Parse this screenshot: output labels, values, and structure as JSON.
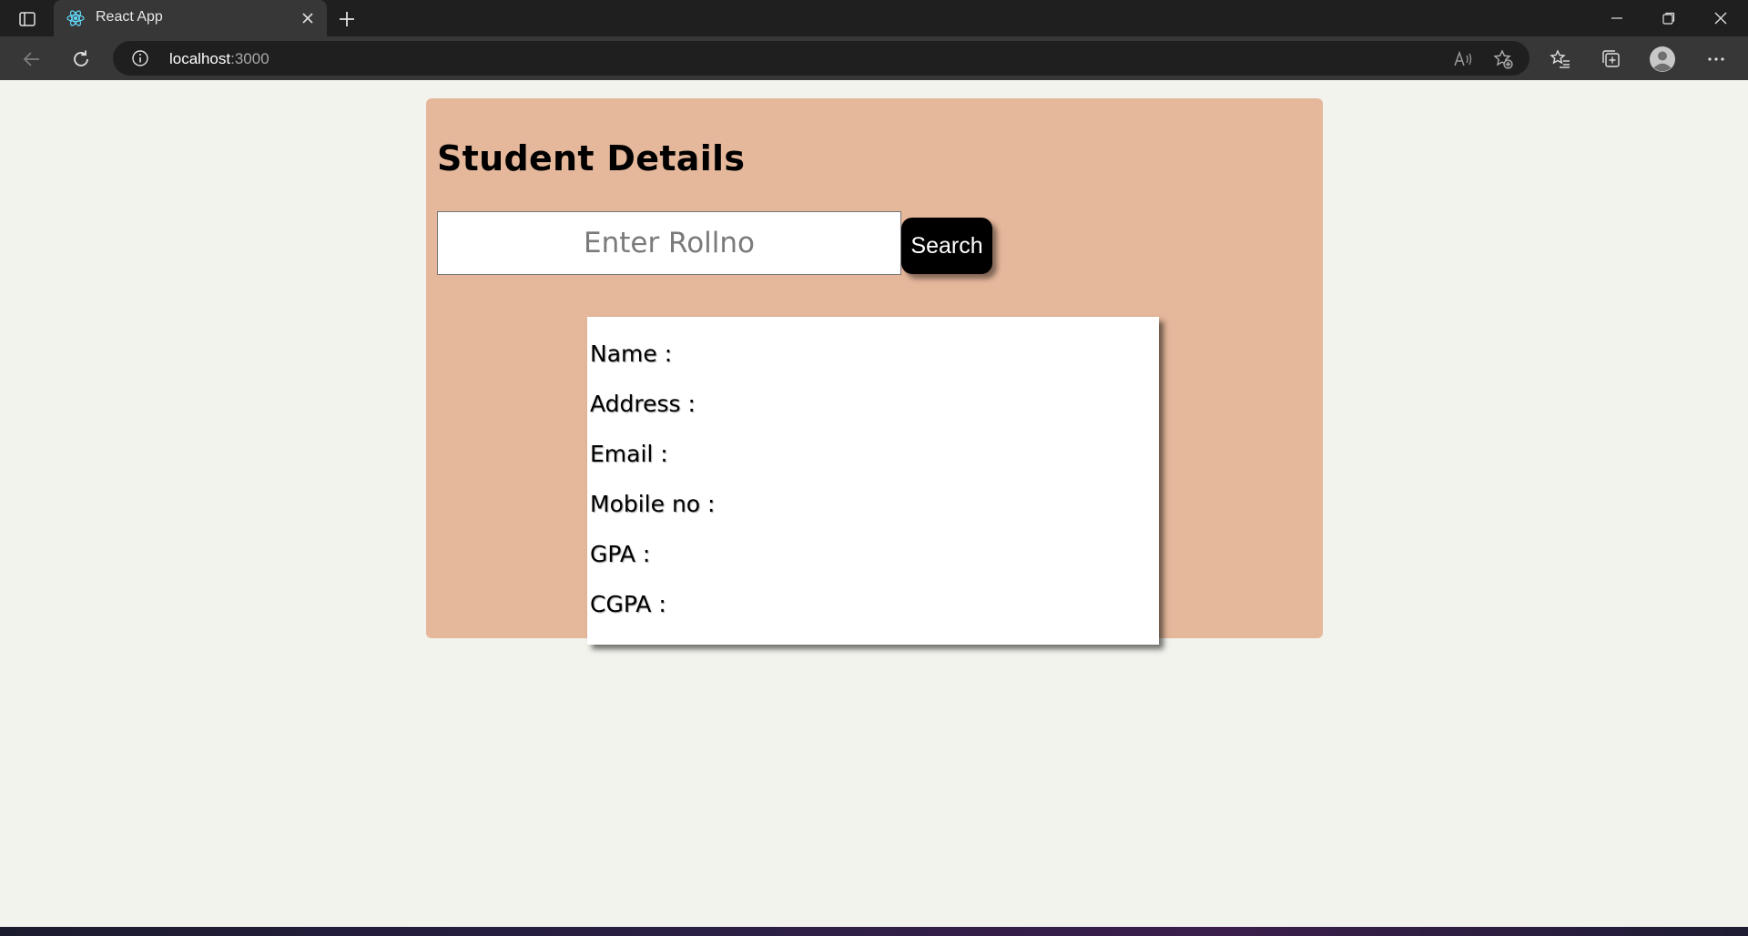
{
  "browser": {
    "tab": {
      "title": "React App",
      "favicon": "react-atom-icon"
    },
    "url": {
      "host": "localhost",
      "port": ":3000"
    }
  },
  "page": {
    "title": "Student Details",
    "search": {
      "placeholder": "Enter Rollno",
      "value": "",
      "button_label": "Search"
    },
    "details": [
      {
        "label": "Name :"
      },
      {
        "label": "Address :"
      },
      {
        "label": "Email :"
      },
      {
        "label": "Mobile no :"
      },
      {
        "label": "GPA :"
      },
      {
        "label": "CGPA :"
      }
    ]
  },
  "colors": {
    "card_background": "#e5b79b",
    "page_background": "#f3f3ee",
    "button_background": "#000000"
  }
}
